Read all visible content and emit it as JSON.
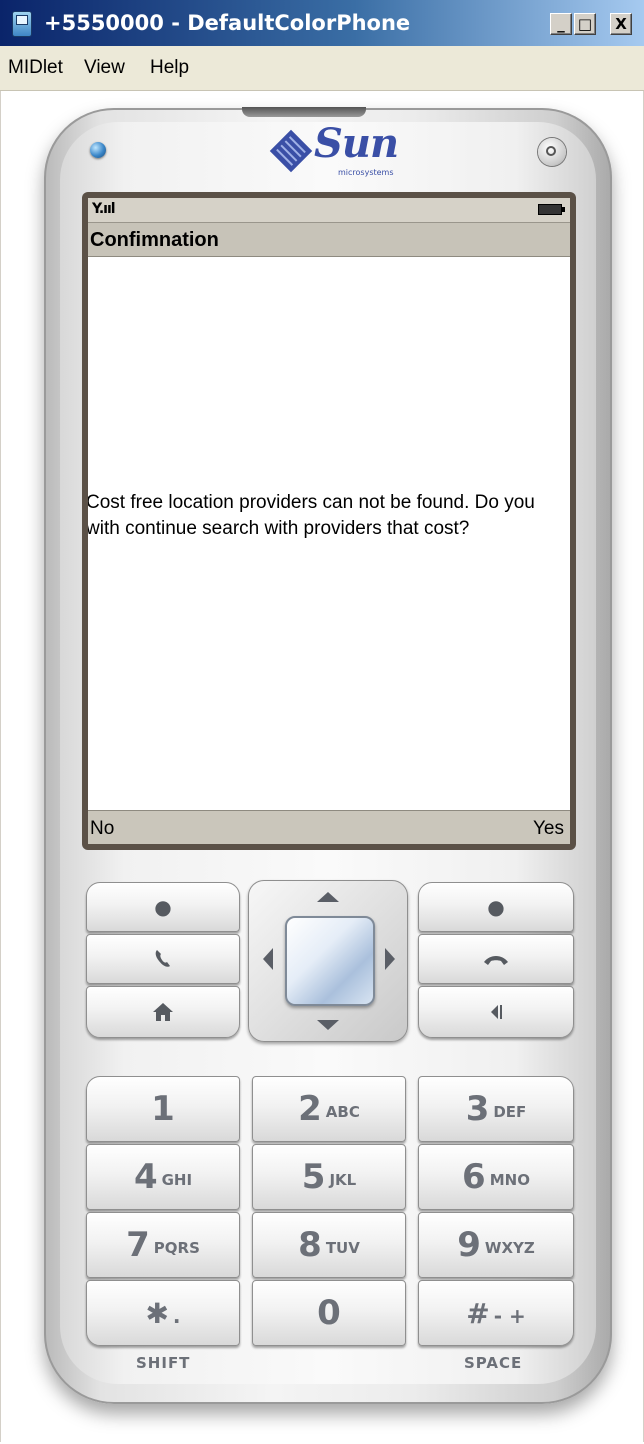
{
  "window": {
    "title": "+5550000 - DefaultColorPhone",
    "minimize_glyph": "_",
    "maximize_glyph": "□",
    "close_glyph": "X"
  },
  "menu": {
    "items": [
      "MIDlet",
      "View",
      "Help"
    ]
  },
  "brand": {
    "name": "Sun",
    "sub": "microsystems"
  },
  "screen": {
    "signal": "Y.ııl",
    "title": "Confimnation",
    "message": "Cost free location providers can not be found. Do you with continue search with providers that cost?",
    "softkey_left": "No",
    "softkey_right": "Yes"
  },
  "keys": [
    {
      "digit": "1",
      "letters": ""
    },
    {
      "digit": "2",
      "letters": "ABC"
    },
    {
      "digit": "3",
      "letters": "DEF"
    },
    {
      "digit": "4",
      "letters": "GHI"
    },
    {
      "digit": "5",
      "letters": "JKL"
    },
    {
      "digit": "6",
      "letters": "MNO"
    },
    {
      "digit": "7",
      "letters": "PQRS"
    },
    {
      "digit": "8",
      "letters": "TUV"
    },
    {
      "digit": "9",
      "letters": "WXYZ"
    },
    {
      "digit": "✱",
      "letters": "."
    },
    {
      "digit": "0",
      "letters": ""
    },
    {
      "digit": "#",
      "letters": "- +"
    }
  ],
  "labels": {
    "shift": "SHIFT",
    "space": "SPACE"
  },
  "icons": {
    "left_soft": "dot-icon",
    "right_soft": "dot-icon",
    "send": "phone-handset-icon",
    "end": "hang-up-icon",
    "home": "home-icon",
    "back": "back-icon",
    "power": "power-icon"
  },
  "colors": {
    "titlebar": "#0a246a",
    "screen_bg": "#ffffff",
    "status_bar": "#d6d2c8",
    "logo": "#3a4fa6"
  }
}
